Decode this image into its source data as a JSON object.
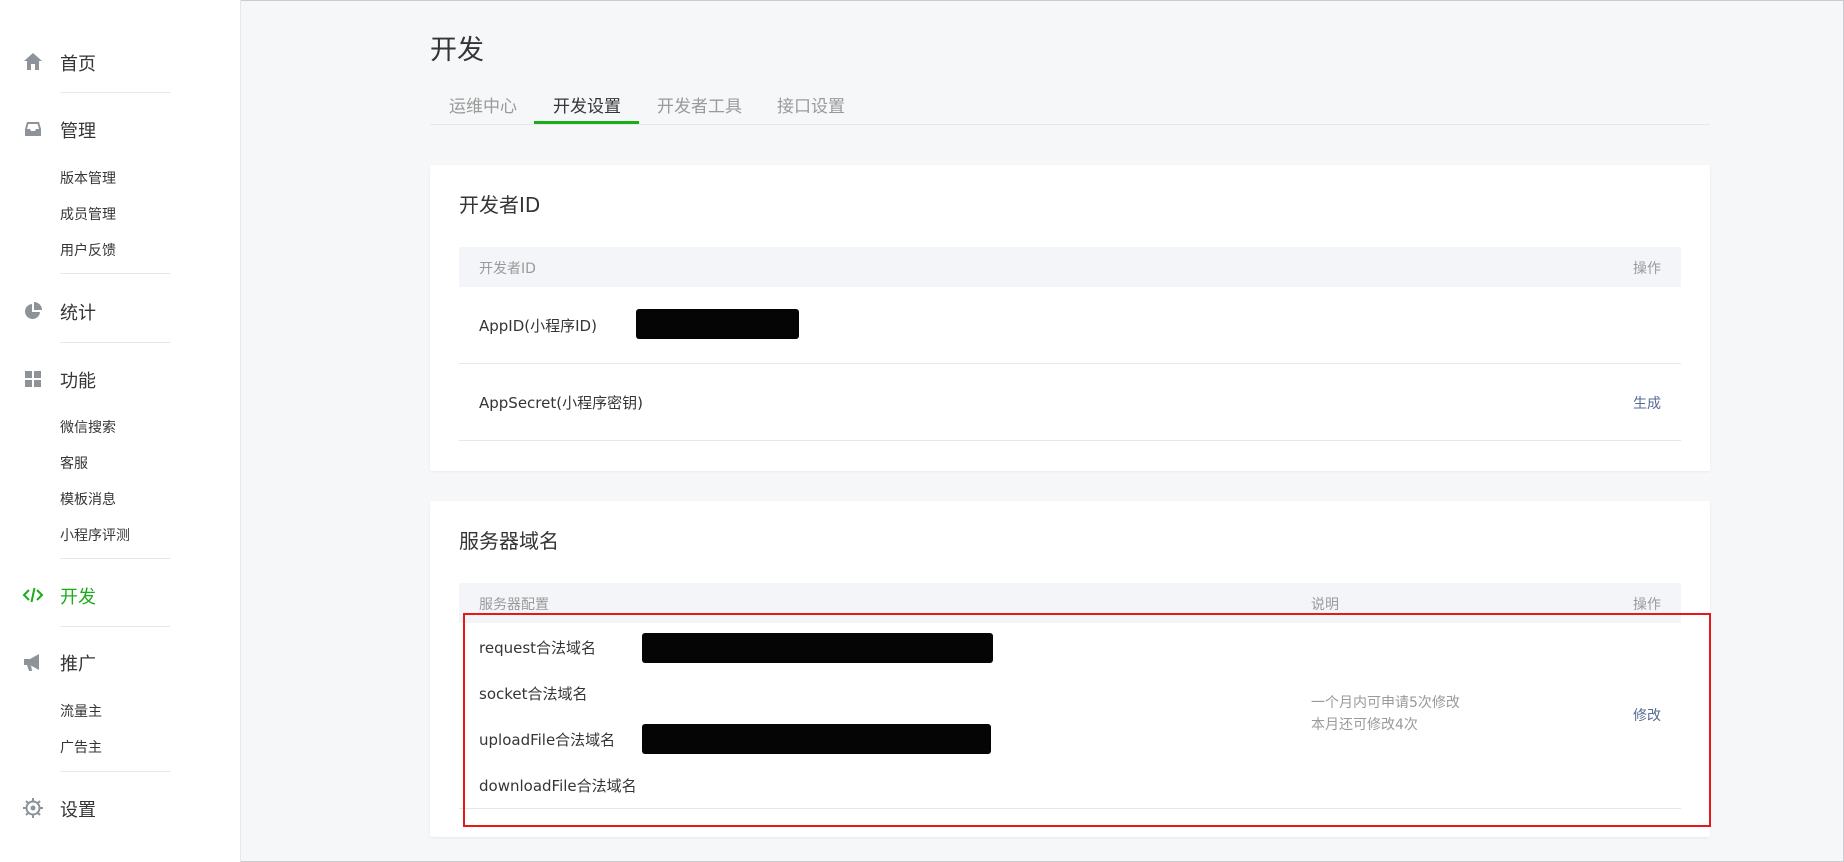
{
  "sidebar": {
    "home": {
      "label": "首页",
      "icon": "home-icon"
    },
    "manage": {
      "label": "管理",
      "icon": "inbox-icon",
      "items": [
        "版本管理",
        "成员管理",
        "用户反馈"
      ]
    },
    "stats": {
      "label": "统计",
      "icon": "pie-chart-icon"
    },
    "features": {
      "label": "功能",
      "icon": "grid-icon",
      "items": [
        "微信搜索",
        "客服",
        "模板消息",
        "小程序评测"
      ]
    },
    "develop": {
      "label": "开发",
      "icon": "code-icon",
      "active": true
    },
    "promote": {
      "label": "推广",
      "icon": "megaphone-icon",
      "items": [
        "流量主",
        "广告主"
      ]
    },
    "settings": {
      "label": "设置",
      "icon": "gear-icon"
    }
  },
  "page": {
    "title": "开发",
    "tabs": [
      "运维中心",
      "开发设置",
      "开发者工具",
      "接口设置"
    ],
    "active_tab": "开发设置"
  },
  "developer_id": {
    "title": "开发者ID",
    "columns": {
      "name": "开发者ID",
      "action": "操作"
    },
    "rows": [
      {
        "name": "AppID(小程序ID)",
        "value": "",
        "action": ""
      },
      {
        "name": "AppSecret(小程序密钥)",
        "value": "",
        "action": "生成"
      }
    ]
  },
  "server_domains": {
    "title": "服务器域名",
    "columns": {
      "config": "服务器配置",
      "desc": "说明",
      "action": "操作"
    },
    "rows": [
      {
        "name": "request合法域名"
      },
      {
        "name": "socket合法域名"
      },
      {
        "name": "uploadFile合法域名"
      },
      {
        "name": "downloadFile合法域名"
      }
    ],
    "note_line1": "一个月内可申请5次修改",
    "note_line2": "本月还可修改4次",
    "action": "修改"
  },
  "colors": {
    "accent": "#1aad19",
    "link": "#576b95",
    "highlight": "#e5191a"
  }
}
